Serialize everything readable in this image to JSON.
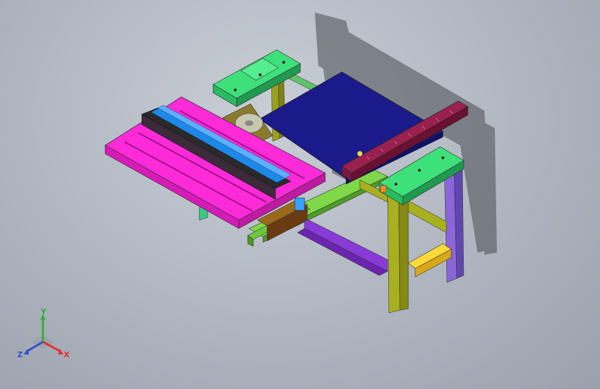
{
  "triad": {
    "x_label": "X",
    "y_label": "Y",
    "z_label": "Z",
    "colors": {
      "x": "#e03030",
      "y": "#30b030",
      "z": "#3050d0"
    }
  },
  "model": {
    "description_parts": [
      "magenta-sliding-table",
      "blue-rip-fence-rail",
      "saw-blade",
      "navy-extension-table",
      "maroon-miter-fence",
      "green-end-caps",
      "olive-leg-frame",
      "purple-legs",
      "yellow-stretcher"
    ]
  }
}
